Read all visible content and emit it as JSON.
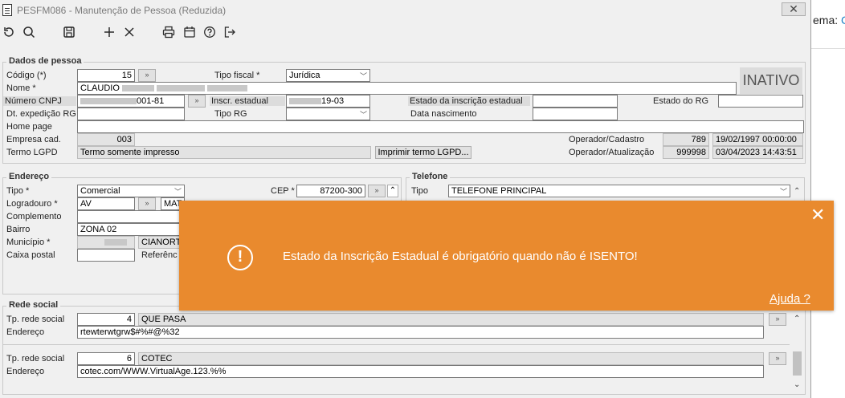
{
  "background": {
    "partial_text": "ema: ",
    "partial_accent": "C"
  },
  "window": {
    "title": "PESFM086 - Manutenção de Pessoa (Reduzida)",
    "close_glyph": "✕"
  },
  "toolbar": {
    "icons": [
      "refresh-icon",
      "search-icon",
      "save-icon",
      "add-icon",
      "delete-icon",
      "print-icon",
      "calendar-icon",
      "help-icon",
      "exit-icon"
    ]
  },
  "dados": {
    "title": "Dados de pessoa",
    "codigo_label": "Código (*)",
    "codigo_value": "15",
    "tipo_fiscal_label": "Tipo fiscal *",
    "tipo_fiscal_value": "Jurídica",
    "status": "INATIVO",
    "nome_label": "Nome *",
    "nome_value": "CLAUDIO",
    "cnpj_label": "Número CNPJ",
    "cnpj_value_suffix": "001-81",
    "inscr_label": "Inscr. estadual",
    "inscr_value_suffix": "19-03",
    "estado_inscr_label": "Estado da inscrição estadual",
    "estado_rg_label": "Estado do RG",
    "dt_exp_label": "Dt. expedição RG",
    "tipo_rg_label": "Tipo RG",
    "data_nasc_label": "Data nascimento",
    "home_page_label": "Home page",
    "empresa_label": "Empresa cad.",
    "empresa_value": "003",
    "operador_cad_label": "Operador/Cadastro",
    "operador_cad_value": "789",
    "operador_cad_date": "19/02/1997 00:00:00",
    "termo_label": "Termo LGPD",
    "termo_value": "Termo somente impresso",
    "imprimir_button": "Imprimir termo LGPD...",
    "operador_atu_label": "Operador/Atualização",
    "operador_atu_value": "999998",
    "operador_atu_date": "03/04/2023 14:43:51"
  },
  "endereco": {
    "title": "Endereço",
    "tipo_label": "Tipo *",
    "tipo_value": "Comercial",
    "cep_label": "CEP *",
    "cep_value": "87200-300",
    "logradouro_label": "Logradouro *",
    "logradouro_value": "AV",
    "logradouro_partial": "MAT",
    "complemento_label": "Complemento",
    "bairro_label": "Bairro",
    "bairro_value": "ZONA 02",
    "municipio_label": "Município *",
    "municipio_name": "CIANORT",
    "caixa_label": "Caixa postal",
    "referencia_label": "Referênc"
  },
  "telefone": {
    "title": "Telefone",
    "tipo_label": "Tipo",
    "tipo_value": "TELEFONE PRINCIPAL"
  },
  "rede_social": {
    "title": "Rede social",
    "entries": [
      {
        "tp_label": "Tp. rede social",
        "tp_code": "4",
        "tp_name": "QUE PASA",
        "end_label": "Endereço",
        "end_value": "rtewterwtgrw$#%#@%32"
      },
      {
        "tp_label": "Tp. rede social",
        "tp_code": "6",
        "tp_name": "COTEC",
        "end_label": "Endereço",
        "end_value": "cotec.com/WWW.VirtualAge.123.%%"
      }
    ]
  },
  "toast": {
    "icon": "!",
    "message": "Estado da Inscrição Estadual é obrigatório quando não é ISENTO!",
    "help_link": "Ajuda ?",
    "close_glyph": "✕",
    "color": "#e98a2e"
  }
}
